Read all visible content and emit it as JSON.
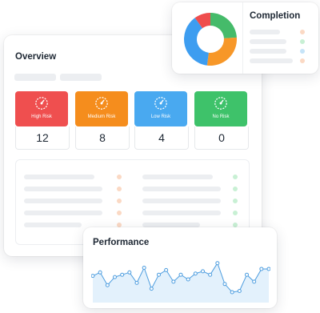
{
  "overview": {
    "title": "Overview",
    "risks": [
      {
        "label": "High Risk",
        "count": "12",
        "color": "#ef4f4f"
      },
      {
        "label": "Medium Risk",
        "count": "8",
        "color": "#f58d1d"
      },
      {
        "label": "Low Risk",
        "count": "4",
        "color": "#49a9f0"
      },
      {
        "label": "No Risk",
        "count": "0",
        "color": "#3ec26a"
      }
    ],
    "dot_colors": [
      "#fbd9c4",
      "#c8f0d4"
    ]
  },
  "completion": {
    "title": "Completion",
    "chart_data": {
      "type": "pie",
      "slices": [
        {
          "value": 24,
          "color": "#45bb6a"
        },
        {
          "value": 28,
          "color": "#f79728"
        },
        {
          "value": 38,
          "color": "#3d9df0"
        },
        {
          "value": 10,
          "color": "#ef4d4d"
        }
      ]
    },
    "legend_dot_colors": [
      "#fbd9c4",
      "#c8f0d4",
      "#c6e4f8",
      "#fbd9c4"
    ]
  },
  "performance": {
    "title": "Performance",
    "chart_data": {
      "type": "area",
      "x": [
        0,
        1,
        2,
        3,
        4,
        5,
        6,
        7,
        8,
        9,
        10,
        11,
        12,
        13,
        14,
        15,
        16,
        17,
        18,
        19,
        20,
        21,
        22,
        23,
        24
      ],
      "values": [
        23,
        26,
        15,
        22,
        24,
        26,
        17,
        30,
        12,
        24,
        28,
        18,
        24,
        20,
        25,
        27,
        24,
        34,
        16,
        9,
        10,
        24,
        18,
        29,
        29
      ],
      "ylim": [
        0,
        40
      ],
      "line_color": "#4d9ddf",
      "fill_color": "#e3f1fc"
    }
  }
}
